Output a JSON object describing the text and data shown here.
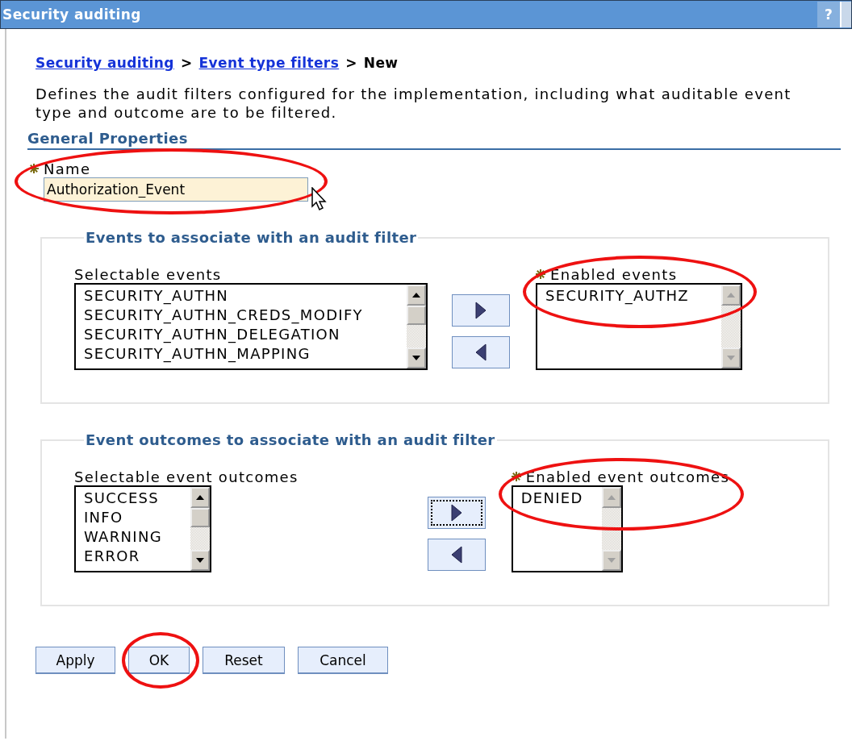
{
  "window": {
    "title": "Security auditing",
    "help": "?"
  },
  "breadcrumb": [
    {
      "text": "Security auditing",
      "kind": "link"
    },
    {
      "text": ">",
      "kind": "separator"
    },
    {
      "text": "Event type filters",
      "kind": "link"
    },
    {
      "text": ">",
      "kind": "separator"
    },
    {
      "text": "New",
      "kind": "current"
    }
  ],
  "description": "Defines the audit filters configured for the implementation, including what auditable event type and outcome are to be filtered.",
  "section_title": "General Properties",
  "name_field": {
    "label": "Name",
    "required": true,
    "value": "Authorization_Event",
    "highlighted": true
  },
  "groups": [
    {
      "legend": "Events to associate with an audit filter",
      "available": {
        "label": "Selectable events",
        "scrollable": true,
        "items": [
          "SECURITY_AUTHN",
          "SECURITY_AUTHN_CREDS_MODIFY",
          "SECURITY_AUTHN_DELEGATION",
          "SECURITY_AUTHN_MAPPING"
        ]
      },
      "add_focused": false,
      "enabled": {
        "label": "Enabled events",
        "required": true,
        "highlighted": true,
        "scrollable": false,
        "items": [
          "SECURITY_AUTHZ"
        ]
      }
    },
    {
      "legend": "Event outcomes to associate with an audit filter",
      "available": {
        "label": "Selectable event outcomes",
        "scrollable": true,
        "items": [
          "SUCCESS",
          "INFO",
          "WARNING",
          "ERROR"
        ]
      },
      "add_focused": true,
      "enabled": {
        "label": "Enabled event outcomes",
        "required": true,
        "highlighted": true,
        "scrollable": false,
        "items": [
          "DENIED"
        ]
      }
    }
  ],
  "buttons": [
    {
      "label": "Apply",
      "highlighted": false
    },
    {
      "label": "OK",
      "highlighted": true
    },
    {
      "label": "Reset",
      "highlighted": false
    },
    {
      "label": "Cancel",
      "highlighted": false
    }
  ]
}
